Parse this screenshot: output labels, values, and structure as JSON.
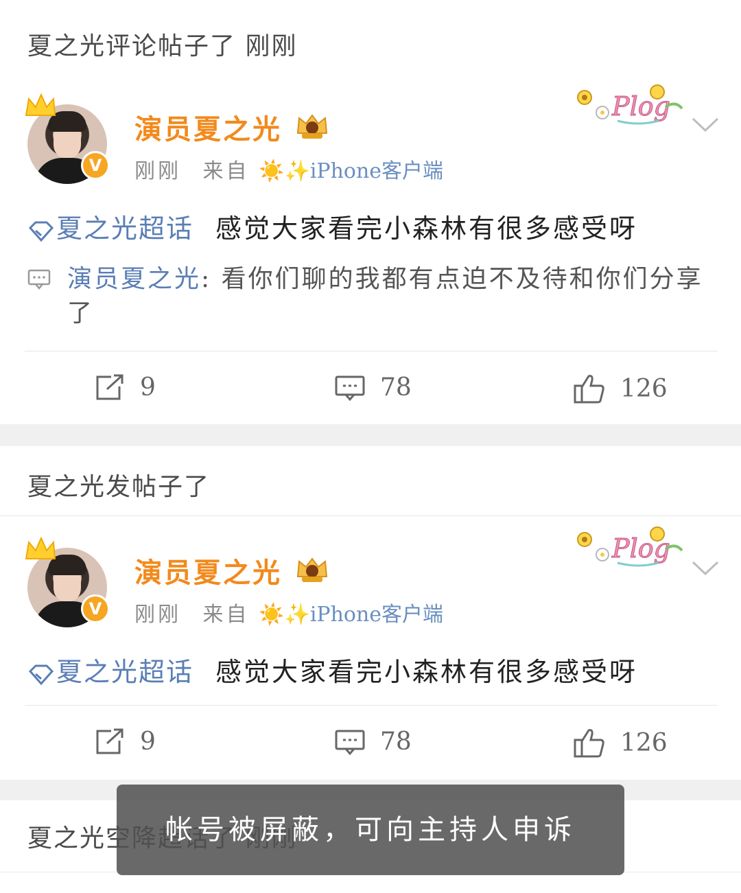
{
  "items": [
    {
      "header": "夏之光评论帖子了 刚刚",
      "username": "演员夏之光",
      "meta_time": "刚刚",
      "meta_from": "来自",
      "meta_emoji": "☀️✨",
      "meta_source": "iPhone客户端",
      "topic": "夏之光超话",
      "text": "感觉大家看完小森林有很多感受呀",
      "comment_user": "演员夏之光",
      "comment_colon": ":",
      "comment_text": "看你们聊的我都有点迫不及待和你们分享了",
      "reposts": "9",
      "comments": "78",
      "likes": "126"
    },
    {
      "header": "夏之光发帖子了",
      "username": "演员夏之光",
      "meta_time": "刚刚",
      "meta_from": "来自",
      "meta_emoji": "☀️✨",
      "meta_source": "iPhone客户端",
      "topic": "夏之光超话",
      "text": "感觉大家看完小森林有很多感受呀",
      "reposts": "9",
      "comments": "78",
      "likes": "126"
    },
    {
      "header": "夏之光空降超话了 刚刚"
    }
  ],
  "toast": "帐号被屏蔽，可向主持人申诉",
  "colors": {
    "username": "#f28a1c",
    "topic": "#5a7eb5",
    "gap": "#f0f0f0"
  }
}
